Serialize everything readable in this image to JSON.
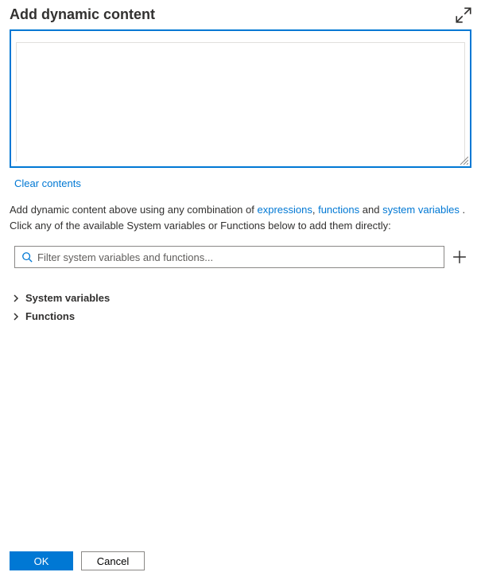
{
  "header": {
    "title": "Add dynamic content"
  },
  "editor": {
    "value": ""
  },
  "actions": {
    "clear": "Clear contents"
  },
  "helper": {
    "prefix": "Add dynamic content above using any combination of ",
    "link_expressions": "expressions",
    "sep1": ", ",
    "link_functions": "functions",
    "sep2": " and ",
    "link_system_variables": "system variables",
    "suffix": " . Click any of the available System variables or Functions below to add them directly:"
  },
  "search": {
    "placeholder": "Filter system variables and functions..."
  },
  "tree": {
    "system_variables": "System variables",
    "functions": "Functions"
  },
  "footer": {
    "ok": "OK",
    "cancel": "Cancel"
  }
}
